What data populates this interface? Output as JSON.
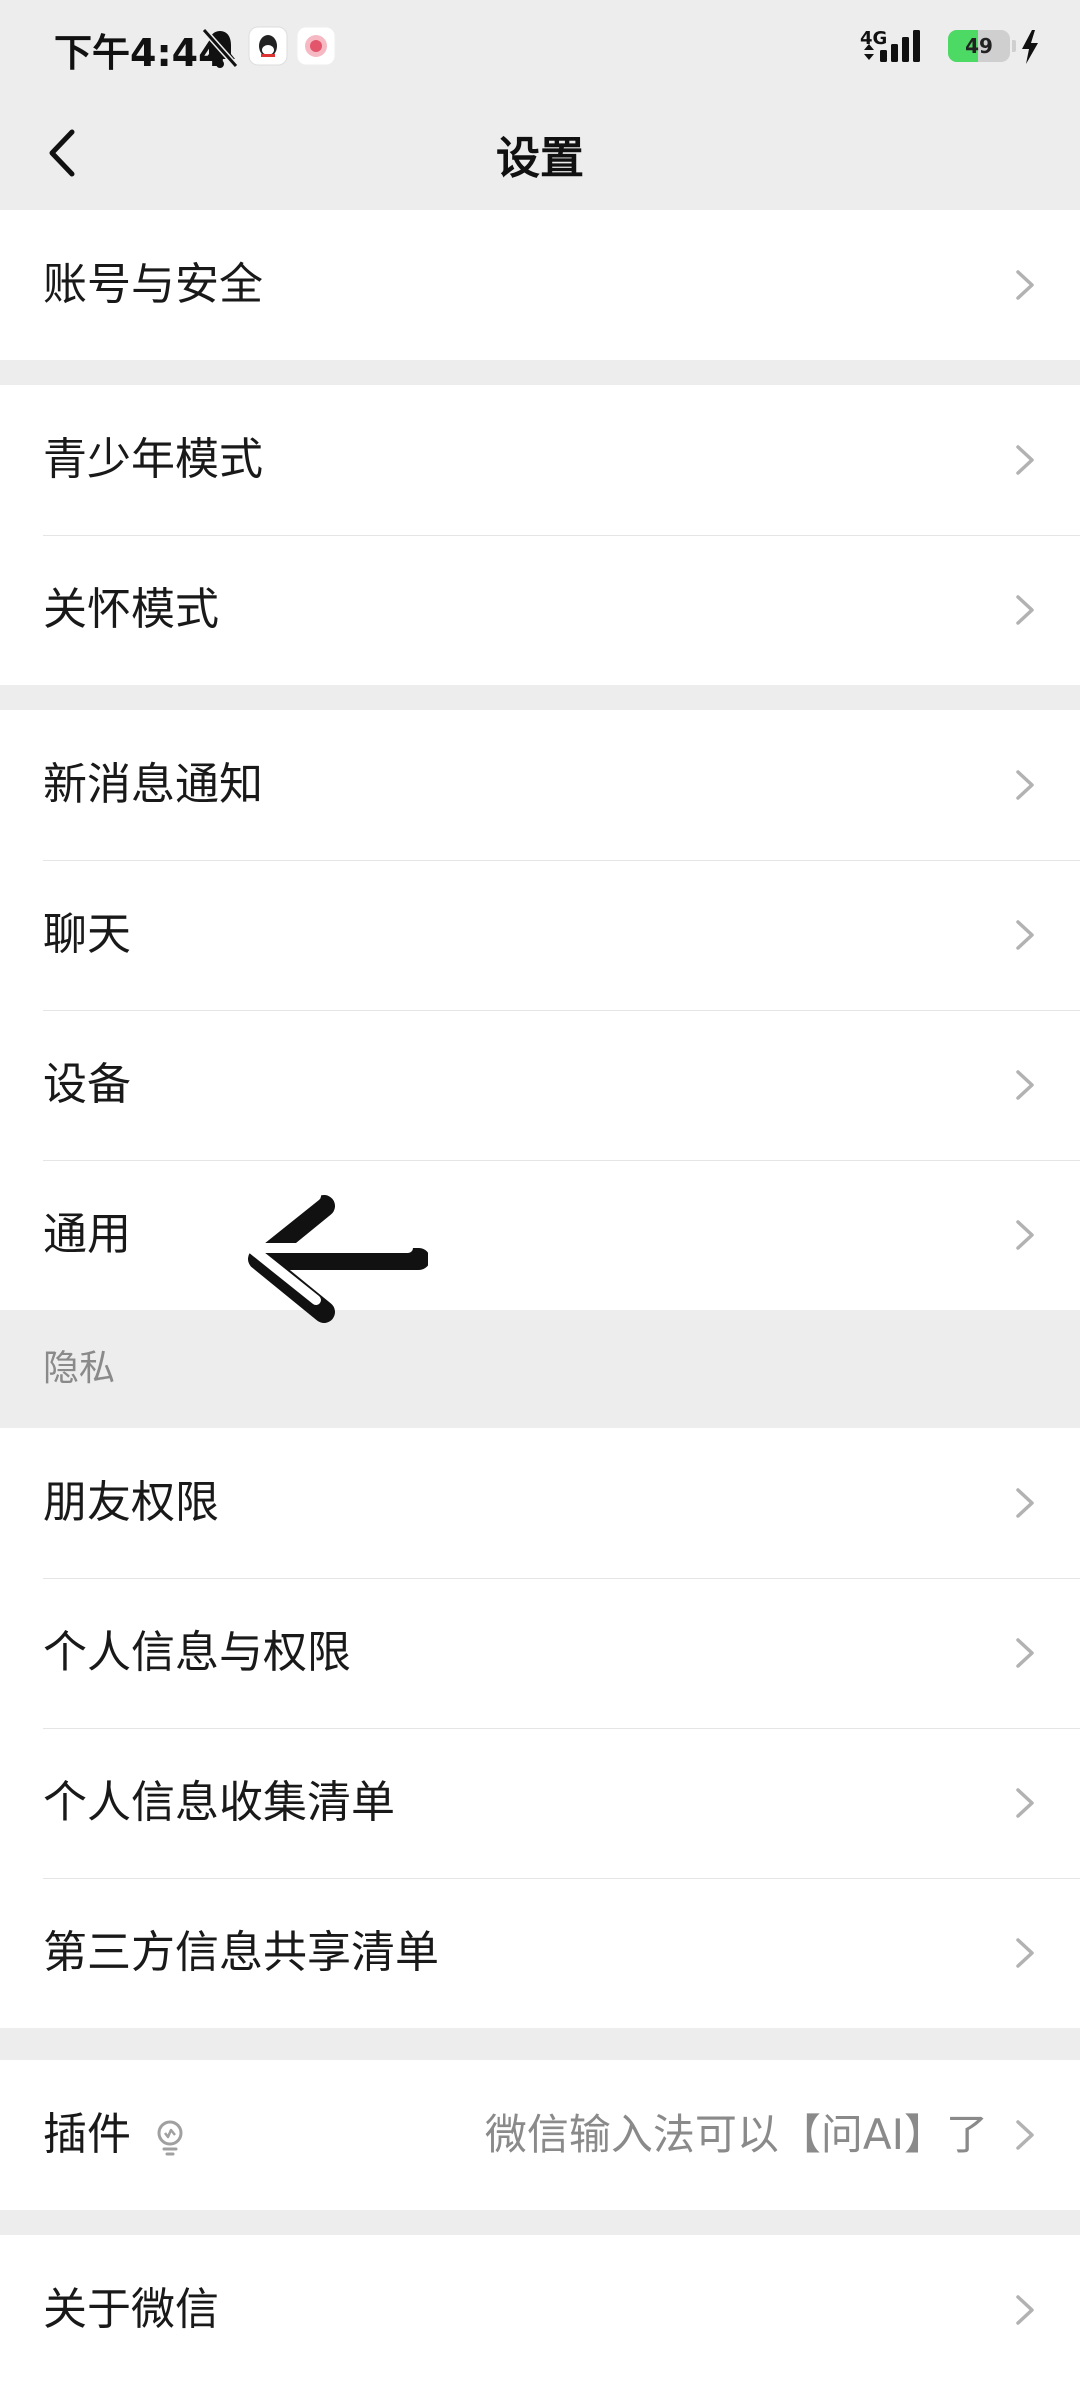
{
  "status_bar": {
    "time": "下午4:44",
    "network": "4G",
    "battery": "49"
  },
  "nav": {
    "title": "设置"
  },
  "groups": [
    {
      "items": [
        {
          "label": "账号与安全"
        }
      ]
    },
    {
      "items": [
        {
          "label": "青少年模式"
        },
        {
          "label": "关怀模式"
        }
      ]
    },
    {
      "items": [
        {
          "label": "新消息通知"
        },
        {
          "label": "聊天"
        },
        {
          "label": "设备"
        },
        {
          "label": "通用"
        }
      ]
    },
    {
      "header": "隐私",
      "items": [
        {
          "label": "朋友权限"
        },
        {
          "label": "个人信息与权限"
        },
        {
          "label": "个人信息收集清单"
        },
        {
          "label": "第三方信息共享清单"
        }
      ]
    },
    {
      "items": [
        {
          "label": "插件",
          "value": "微信输入法可以【问AI】了"
        }
      ]
    },
    {
      "items": [
        {
          "label": "关于微信"
        }
      ]
    }
  ],
  "colors": {
    "background": "#EDEDED",
    "cell": "#FFFFFF",
    "text": "#191919",
    "secondary_text": "#8A8A8A",
    "battery_green": "#4CD964"
  }
}
